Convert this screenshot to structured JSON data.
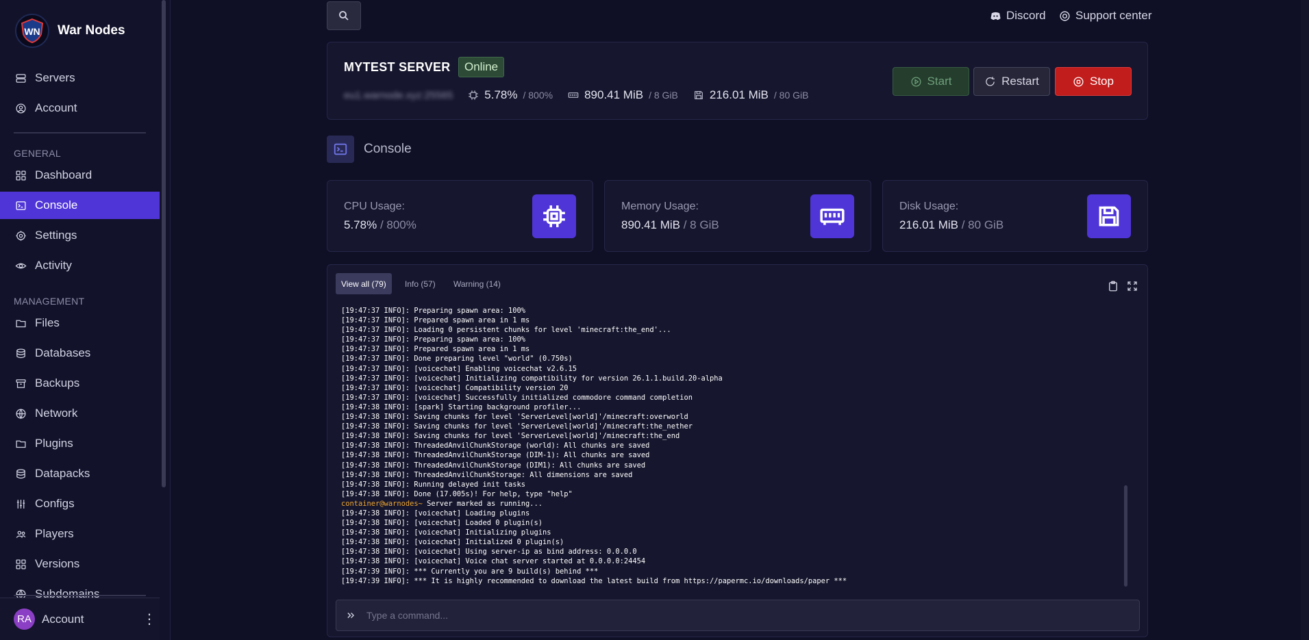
{
  "brand": {
    "name": "War Nodes",
    "logo_text": "WN"
  },
  "sidebar": {
    "top_items": [
      {
        "label": "Servers",
        "icon": "server-icon"
      },
      {
        "label": "Account",
        "icon": "user-circle-icon"
      }
    ],
    "general_label": "GENERAL",
    "general_items": [
      {
        "label": "Dashboard",
        "icon": "grid-icon"
      },
      {
        "label": "Console",
        "icon": "terminal-icon",
        "active": true
      },
      {
        "label": "Settings",
        "icon": "gear-icon"
      },
      {
        "label": "Activity",
        "icon": "eye-icon"
      }
    ],
    "management_label": "MANAGEMENT",
    "management_items": [
      {
        "label": "Files",
        "icon": "folder-icon"
      },
      {
        "label": "Databases",
        "icon": "database-icon"
      },
      {
        "label": "Backups",
        "icon": "archive-icon"
      },
      {
        "label": "Network",
        "icon": "globe-icon"
      },
      {
        "label": "Plugins",
        "icon": "folder-icon"
      },
      {
        "label": "Datapacks",
        "icon": "database-icon"
      },
      {
        "label": "Configs",
        "icon": "sliders-icon"
      },
      {
        "label": "Players",
        "icon": "users-icon"
      },
      {
        "label": "Versions",
        "icon": "grid-icon"
      },
      {
        "label": "Subdomains",
        "icon": "globe-icon"
      }
    ],
    "footer": {
      "avatar_initials": "RA",
      "name": "Account"
    }
  },
  "topbar": {
    "discord_label": "Discord",
    "support_label": "Support center"
  },
  "server": {
    "name": "MYTEST SERVER",
    "status": "Online",
    "address": "eu1.warnode.xyz:25565",
    "cpu": "5.78%",
    "cpu_limit": "/ 800%",
    "memory": "890.41 MiB",
    "memory_limit": "/ 8 GiB",
    "disk": "216.01 MiB",
    "disk_limit": "/ 80 GiB",
    "start_label": "Start",
    "restart_label": "Restart",
    "stop_label": "Stop"
  },
  "console_heading": "Console",
  "resources": {
    "cpu_label": "CPU Usage:",
    "cpu_value": "5.78%",
    "cpu_limit": "/ 800%",
    "memory_label": "Memory Usage:",
    "memory_value": "890.41 MiB",
    "memory_limit": "/ 8 GiB",
    "disk_label": "Disk Usage:",
    "disk_value": "216.01 MiB",
    "disk_limit": "/ 80 GiB"
  },
  "console": {
    "tabs": [
      "View all (79)",
      "Info (57)",
      "Warning (14)"
    ],
    "prompt_prefix": "container@warnodes~",
    "lines": [
      "[19:47:37 INFO]: Preparing spawn area: 100%",
      "[19:47:37 INFO]: Prepared spawn area in 1 ms",
      "[19:47:37 INFO]: Loading 0 persistent chunks for level 'minecraft:the_end'...",
      "[19:47:37 INFO]: Preparing spawn area: 100%",
      "[19:47:37 INFO]: Prepared spawn area in 1 ms",
      "[19:47:37 INFO]: Done preparing level \"world\" (0.750s)",
      "[19:47:37 INFO]: [voicechat] Enabling voicechat v2.6.15",
      "[19:47:37 INFO]: [voicechat] Initializing compatibility for version 26.1.1.build.20-alpha",
      "[19:47:37 INFO]: [voicechat] Compatibility version 20",
      "[19:47:37 INFO]: [voicechat] Successfully initialized commodore command completion",
      "[19:47:38 INFO]: [spark] Starting background profiler...",
      "[19:47:38 INFO]: Saving chunks for level 'ServerLevel[world]'/minecraft:overworld",
      "[19:47:38 INFO]: Saving chunks for level 'ServerLevel[world]'/minecraft:the_nether",
      "[19:47:38 INFO]: Saving chunks for level 'ServerLevel[world]'/minecraft:the_end",
      "[19:47:38 INFO]: ThreadedAnvilChunkStorage (world): All chunks are saved",
      "[19:47:38 INFO]: ThreadedAnvilChunkStorage (DIM-1): All chunks are saved",
      "[19:47:38 INFO]: ThreadedAnvilChunkStorage (DIM1): All chunks are saved",
      "[19:47:38 INFO]: ThreadedAnvilChunkStorage: All dimensions are saved",
      "[19:47:38 INFO]: Running delayed init tasks",
      "[19:47:38 INFO]: Done (17.005s)! For help, type \"help\"",
      " Server marked as running...",
      "[19:47:38 INFO]: [voicechat] Loading plugins",
      "[19:47:38 INFO]: [voicechat] Loaded 0 plugin(s)",
      "[19:47:38 INFO]: [voicechat] Initializing plugins",
      "[19:47:38 INFO]: [voicechat] Initialized 0 plugin(s)",
      "[19:47:38 INFO]: [voicechat] Using server-ip as bind address: 0.0.0.0",
      "[19:47:38 INFO]: [voicechat] Voice chat server started at 0.0.0.0:24454",
      "[19:47:39 INFO]: *** Currently you are 9 build(s) behind ***",
      "[19:47:39 INFO]: *** It is highly recommended to download the latest build from https://papermc.io/downloads/paper ***"
    ],
    "command_placeholder": "Type a command..."
  },
  "colors": {
    "accent": "#4f35d8",
    "background": "#0f0f25",
    "panel": "#16162e",
    "stop": "#c21d1d",
    "start": "#243d2d",
    "online_badge": "#2c4a35",
    "prompt": "#f0a830"
  }
}
